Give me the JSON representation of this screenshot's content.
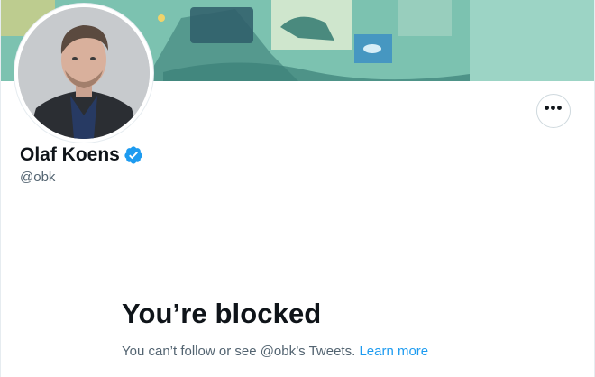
{
  "profile": {
    "display_name": "Olaf Koens",
    "handle": "@obk",
    "verified": true
  },
  "header": {
    "more_options_label": "•••"
  },
  "blocked": {
    "title": "You’re blocked",
    "message": "You can’t follow or see @obk’s Tweets.",
    "learn_more": "Learn more"
  },
  "colors": {
    "accent": "#1d9bf0",
    "text_primary": "#0f1419",
    "text_secondary": "#536471",
    "banner_teal": "#5fae9c"
  },
  "icons": {
    "verified": "verified-badge-icon",
    "more": "more-options-icon"
  }
}
